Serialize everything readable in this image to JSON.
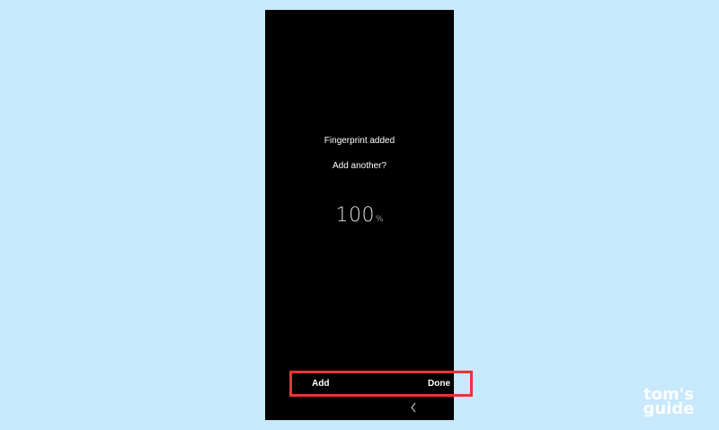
{
  "screen": {
    "title": "Fingerprint added",
    "subtitle": "Add another?",
    "progress_value": "100",
    "progress_unit": "%"
  },
  "actions": {
    "add_label": "Add",
    "done_label": "Done",
    "highlight_color": "#e8343a"
  },
  "navigation": {
    "back_icon": "chevron-left-icon"
  },
  "watermark": {
    "line1": "tom's",
    "line2": "guide"
  },
  "colors": {
    "background": "#c8e8fb",
    "screen": "#000000",
    "text": "#ffffff"
  }
}
